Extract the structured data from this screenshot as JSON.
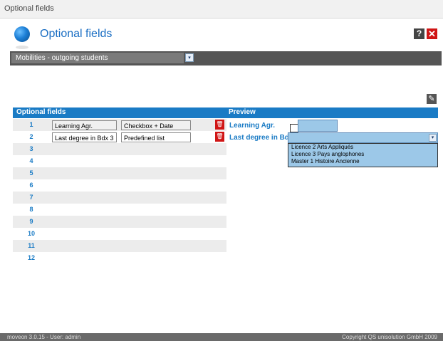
{
  "window": {
    "title": "Optional fields"
  },
  "header": {
    "title": "Optional fields",
    "help_label": "?",
    "close_label": "✕"
  },
  "selector": {
    "value": "Mobilities - outgoing students",
    "arrow": "▾"
  },
  "edit_icon": "✎",
  "table": {
    "headers": {
      "fields": "Optional fields",
      "preview": "Preview"
    },
    "rows": [
      {
        "num": "1",
        "name": "Learning Agr.",
        "type": "Checkbox + Date"
      },
      {
        "num": "2",
        "name": "Last degree in Bdx 3",
        "type": "Predefined list"
      },
      {
        "num": "3"
      },
      {
        "num": "4"
      },
      {
        "num": "5"
      },
      {
        "num": "6"
      },
      {
        "num": "7"
      },
      {
        "num": "8"
      },
      {
        "num": "9"
      },
      {
        "num": "10"
      },
      {
        "num": "11"
      },
      {
        "num": "12"
      }
    ],
    "trash_icon": "🗑"
  },
  "preview": {
    "learning_label": "Learning Agr.",
    "degree_label": "Last degree in Bdx",
    "list_arrow": "▾",
    "options": [
      "Licence 2 Arts Appliqués",
      "Licence 3 Pays anglophones",
      "Master 1 Histoire Ancienne"
    ]
  },
  "footer": {
    "left": "moveon 3.0.15 - User: admin",
    "right": "Copyright QS unisolution GmbH 2009"
  }
}
